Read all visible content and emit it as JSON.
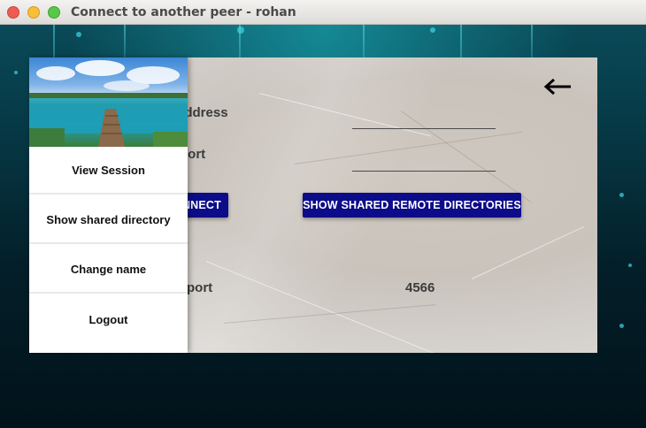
{
  "window": {
    "title": "Connect to another peer - rohan"
  },
  "form": {
    "ip_label": "IP Address",
    "port_label": "port",
    "ip_value": "",
    "port_value": "",
    "connect_label": "NNECT",
    "show_dirs_label": "SHOW SHARED REMOTE DIRECTORIES",
    "your_port_label": "r port",
    "your_port_value": "4566"
  },
  "drawer": {
    "items": [
      {
        "label": "View Session"
      },
      {
        "label": "Show shared directory"
      },
      {
        "label": "Change name"
      },
      {
        "label": "Logout"
      }
    ]
  },
  "colors": {
    "button_bg": "#0c0c8a",
    "card_bg": "#d3cfca"
  }
}
